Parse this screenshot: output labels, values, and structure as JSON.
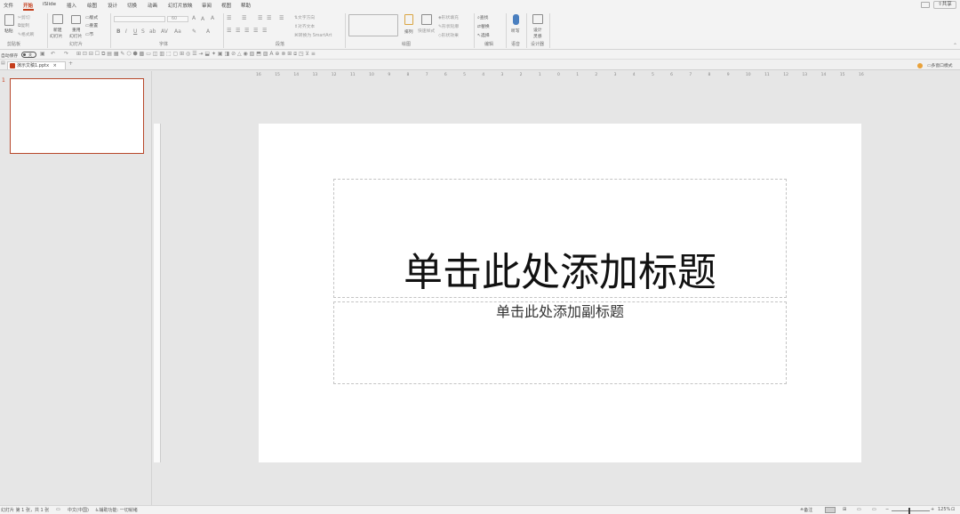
{
  "menu": {
    "items": [
      "文件",
      "开始",
      "iSlide",
      "插入",
      "绘图",
      "设计",
      "切换",
      "动画",
      "幻灯片放映",
      "审阅",
      "视图",
      "帮助"
    ],
    "active": "开始",
    "share_label": "共享",
    "accent": "#c43e1c"
  },
  "ribbon": {
    "clipboard": {
      "paste": "粘贴",
      "cut": "剪切",
      "copy": "复制",
      "format_painter": "格式刷",
      "label": "剪贴板"
    },
    "slides": {
      "new_slide": "新建",
      "new_slide_2": "幻灯片",
      "reuse": "重用",
      "reuse_2": "幻灯片",
      "layout": "版式",
      "reset": "重置",
      "section": "节",
      "label": "幻灯片"
    },
    "font": {
      "size": "60",
      "bold": "B",
      "italic": "I",
      "underline": "U",
      "strike": "S",
      "shadow": "ab",
      "label": "字体"
    },
    "paragraph": {
      "text_direction": "文字方向",
      "align_text": "对齐文本",
      "smartart": "转换为 SmartArt",
      "label": "段落"
    },
    "drawing": {
      "arrange": "排列",
      "quick_styles": "快速样式",
      "shape_fill": "形状填充",
      "shape_outline": "形状轮廓",
      "shape_effects": "形状效果",
      "label": "绘图"
    },
    "editing": {
      "find": "查找",
      "replace": "替换",
      "select": "选择",
      "label": "编辑"
    },
    "voice": {
      "dictate": "听写",
      "label": "语音"
    },
    "designer": {
      "design_ideas": "设计",
      "design_ideas_2": "灵感",
      "label": "设计器"
    }
  },
  "qat": {
    "autosave": "自动保存",
    "toggle_state": "关"
  },
  "document": {
    "tab_name": "演示文稿1.pptx",
    "multi_window": "多窗口模式"
  },
  "thumbnails": [
    {
      "number": "1"
    }
  ],
  "slide": {
    "title_placeholder": "单击此处添加标题",
    "subtitle_placeholder": "单击此处添加副标题"
  },
  "ruler": {
    "h_marks": [
      "16",
      "15",
      "14",
      "13",
      "12",
      "11",
      "10",
      "9",
      "8",
      "7",
      "6",
      "5",
      "4",
      "3",
      "2",
      "1",
      "0",
      "1",
      "2",
      "3",
      "4",
      "5",
      "6",
      "7",
      "8",
      "9",
      "10",
      "11",
      "12",
      "13",
      "14",
      "15",
      "16"
    ]
  },
  "status": {
    "slide_info": "幻灯片 第 1 张，共 1 张",
    "language": "中文(中国)",
    "accessibility": "辅助功能: 一切就绪",
    "notes": "备注",
    "zoom": "125%"
  }
}
